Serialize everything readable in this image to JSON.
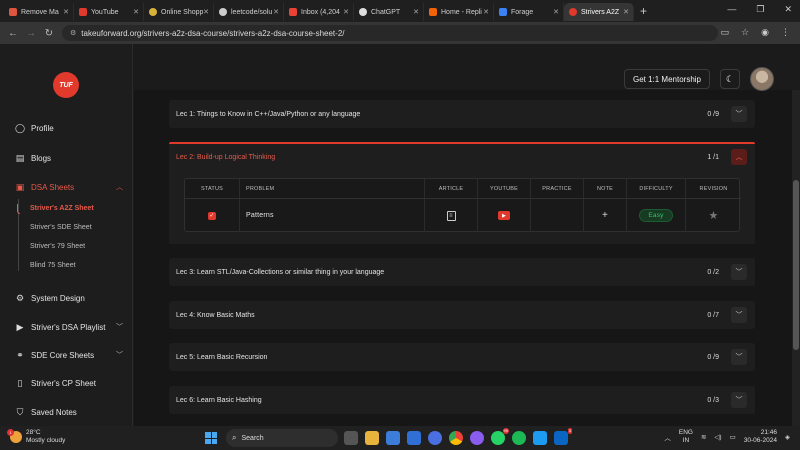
{
  "browser": {
    "tabs": [
      {
        "label": "Remove Ma",
        "color": "#e0553f"
      },
      {
        "label": "YouTube",
        "color": "#e2392d"
      },
      {
        "label": "Online Shopp",
        "color": "#d9b23a"
      },
      {
        "label": "leetcode/solu",
        "color": "#cccccc"
      },
      {
        "label": "Inbox (4,204",
        "color": "#ea4335"
      },
      {
        "label": "ChatGPT",
        "color": "#dddddd"
      },
      {
        "label": "Home - Repli",
        "color": "#f26207"
      },
      {
        "label": "Forage",
        "color": "#3b82f6"
      },
      {
        "label": "Strivers A2Z",
        "color": "#e2392d",
        "active": true
      }
    ],
    "new_tab": "+",
    "url": "takeuforward.org/strivers-a2z-dsa-course/strivers-a2z-dsa-course-sheet-2/"
  },
  "sidebar": {
    "logo": "TUF",
    "items": [
      {
        "label": "Profile",
        "icon": "user-icon"
      },
      {
        "label": "Blogs",
        "icon": "blog-icon"
      },
      {
        "label": "DSA Sheets",
        "icon": "sheet-icon"
      },
      {
        "label": "System Design",
        "icon": "system-icon"
      },
      {
        "label": "Striver's DSA Playlist",
        "icon": "playlist-icon"
      },
      {
        "label": "SDE Core Sheets",
        "icon": "core-icon"
      },
      {
        "label": "Striver's CP Sheet",
        "icon": "cp-icon"
      },
      {
        "label": "Saved Notes",
        "icon": "bookmark-icon"
      }
    ],
    "sub_items": [
      "Striver's A2Z Sheet",
      "Striver's SDE Sheet",
      "Striver's 79 Sheet",
      "Blind 75 Sheet"
    ]
  },
  "header": {
    "mentorship_button": "Get 1:1 Mentorship"
  },
  "lectures": [
    {
      "title": "Lec 1: Things to Know in C++/Java/Python or any language",
      "count": "0 /9"
    },
    {
      "title": "Lec 2: Build-up Logical Thinking",
      "count": "1 /1",
      "open": true
    },
    {
      "title": "Lec 3: Learn STL/Java-Collections or similar thing in your language",
      "count": "0 /2"
    },
    {
      "title": "Lec 4: Know Basic Maths",
      "count": "0 /7"
    },
    {
      "title": "Lec 5: Learn Basic Recursion",
      "count": "0 /9"
    },
    {
      "title": "Lec 6: Learn Basic Hashing",
      "count": "0 /3"
    }
  ],
  "problem_table": {
    "columns": [
      "STATUS",
      "PROBLEM",
      "ARTICLE",
      "YOUTUBE",
      "PRACTICE",
      "NOTE",
      "DIFFICULTY",
      "REVISION"
    ],
    "rows": [
      {
        "status": "checked",
        "problem": "Patterns",
        "difficulty": "Easy"
      }
    ]
  },
  "taskbar": {
    "weather_temp": "28°C",
    "weather_desc": "Mostly cloudy",
    "weather_badge": "1",
    "search": "Search",
    "lang_top": "ENG",
    "lang_bottom": "IN",
    "time": "21:46",
    "date": "30-06-2024",
    "badges": {
      "whatsapp": "99",
      "linkedin": "3"
    }
  },
  "colors": {
    "accent": "#e2392d",
    "easy": "#39c26d"
  }
}
